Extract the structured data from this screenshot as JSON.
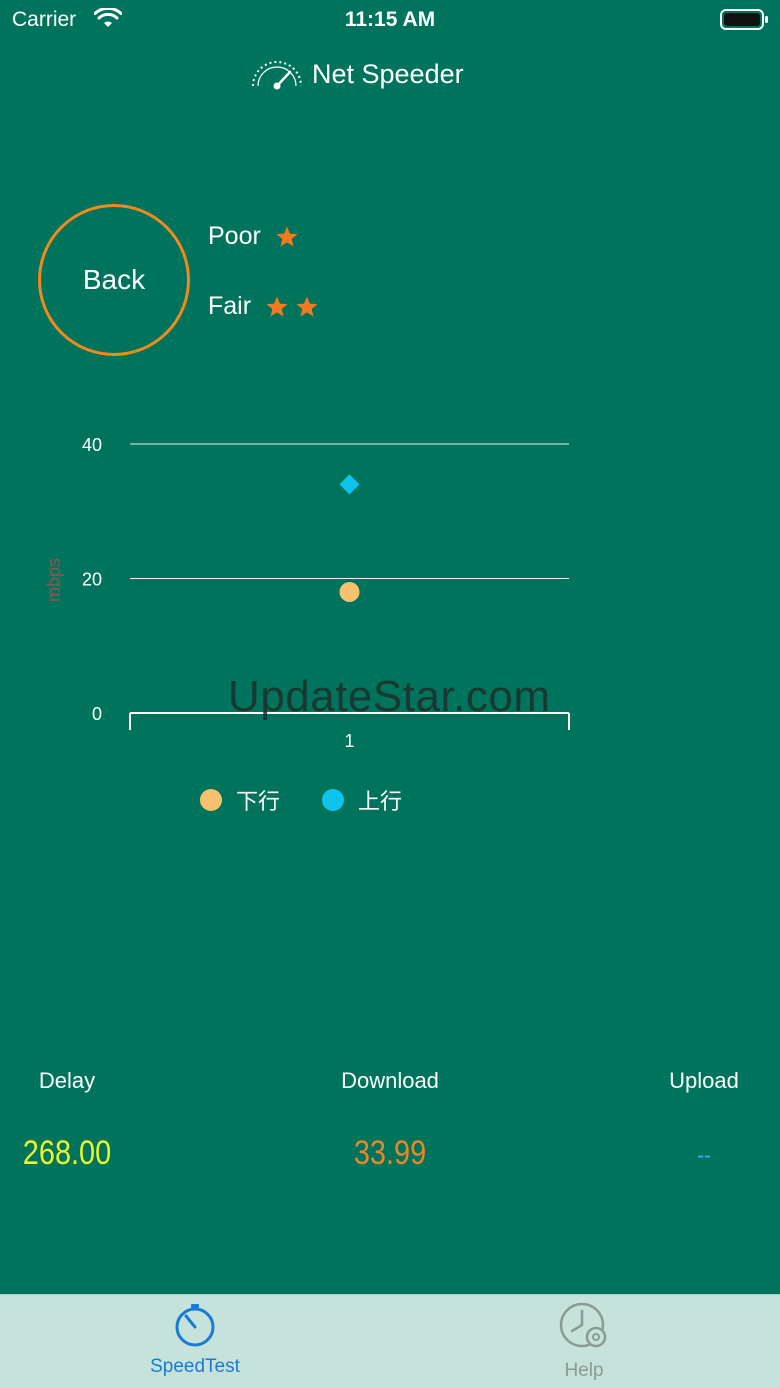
{
  "status_bar": {
    "carrier": "Carrier",
    "time": "11:15 AM"
  },
  "header": {
    "title": "Net Speeder",
    "icon": "speedometer-icon"
  },
  "back_button": {
    "label": "Back"
  },
  "ratings": [
    {
      "label": "Poor",
      "stars": 1
    },
    {
      "label": "Fair",
      "stars": 2
    }
  ],
  "colors": {
    "background": "#00735c",
    "accent_orange": "#f08a1c",
    "star": "#f27a21",
    "download_series": "#f8c170",
    "upload_series": "#0fc3ef",
    "delay_value": "#e8f52a",
    "download_value": "#e6872a",
    "upload_value": "#0fc3ef",
    "tab_active": "#1a7bd6",
    "tab_inactive": "#8a9a95"
  },
  "chart_data": {
    "type": "scatter",
    "categories": [
      "1"
    ],
    "ylabel": "mbps",
    "ylim": [
      0,
      40
    ],
    "yticks": [
      "0",
      "20",
      "40"
    ],
    "grid": true,
    "legend_position": "bottom",
    "series": [
      {
        "name": "下行",
        "marker": "circle",
        "values": [
          18
        ]
      },
      {
        "name": "上行",
        "marker": "diamond",
        "values": [
          34
        ]
      }
    ]
  },
  "watermark": "UpdateStar.com",
  "stats": {
    "delay": {
      "label": "Delay",
      "value": "268.00"
    },
    "download": {
      "label": "Download",
      "value": "33.99"
    },
    "upload": {
      "label": "Upload",
      "value": "--"
    }
  },
  "tabs": [
    {
      "label": "SpeedTest",
      "icon": "stopwatch-icon",
      "active": true
    },
    {
      "label": "Help",
      "icon": "clock-gear-icon",
      "active": false
    }
  ]
}
